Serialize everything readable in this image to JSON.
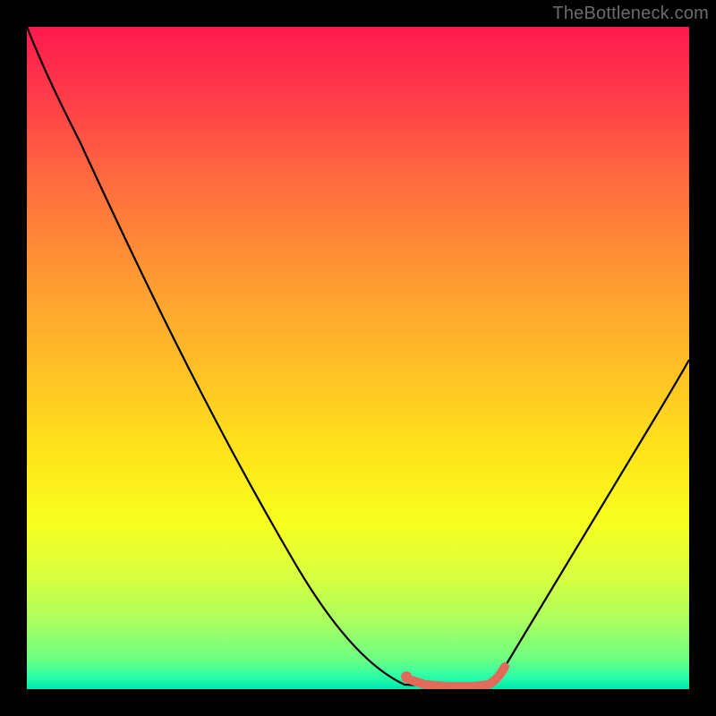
{
  "watermark": "TheBottleneck.com",
  "chart_data": {
    "type": "line",
    "title": "",
    "xlabel": "",
    "ylabel": "",
    "xlim": [
      0,
      100
    ],
    "ylim": [
      0,
      100
    ],
    "grid": false,
    "legend": false,
    "background_gradient": {
      "direction": "vertical",
      "stops": [
        {
          "pos": 0.0,
          "color": "#ff1a4e"
        },
        {
          "pos": 0.5,
          "color": "#ffc424"
        },
        {
          "pos": 0.8,
          "color": "#f7ff1f"
        },
        {
          "pos": 1.0,
          "color": "#00e6b0"
        }
      ]
    },
    "series": [
      {
        "name": "bottleneck-curve",
        "color": "#000000",
        "x": [
          0,
          6,
          12,
          18,
          24,
          30,
          36,
          42,
          48,
          54,
          57,
          60,
          63,
          67,
          71,
          72,
          76,
          80,
          84,
          88,
          92,
          96,
          100
        ],
        "y": [
          100,
          90,
          80,
          70,
          60,
          50,
          40,
          30,
          20,
          10,
          5,
          2,
          0,
          0,
          0,
          2,
          8,
          15,
          22,
          30,
          38,
          46,
          54
        ]
      },
      {
        "name": "optimal-range-marker",
        "color": "#e26a5a",
        "x": [
          57,
          60,
          63,
          67,
          70,
          71,
          72
        ],
        "y": [
          2,
          0.5,
          0,
          0,
          0,
          1,
          3
        ]
      }
    ],
    "annotation": {
      "marker_dot": {
        "x": 57,
        "y": 2,
        "color": "#e26a5a"
      }
    }
  }
}
